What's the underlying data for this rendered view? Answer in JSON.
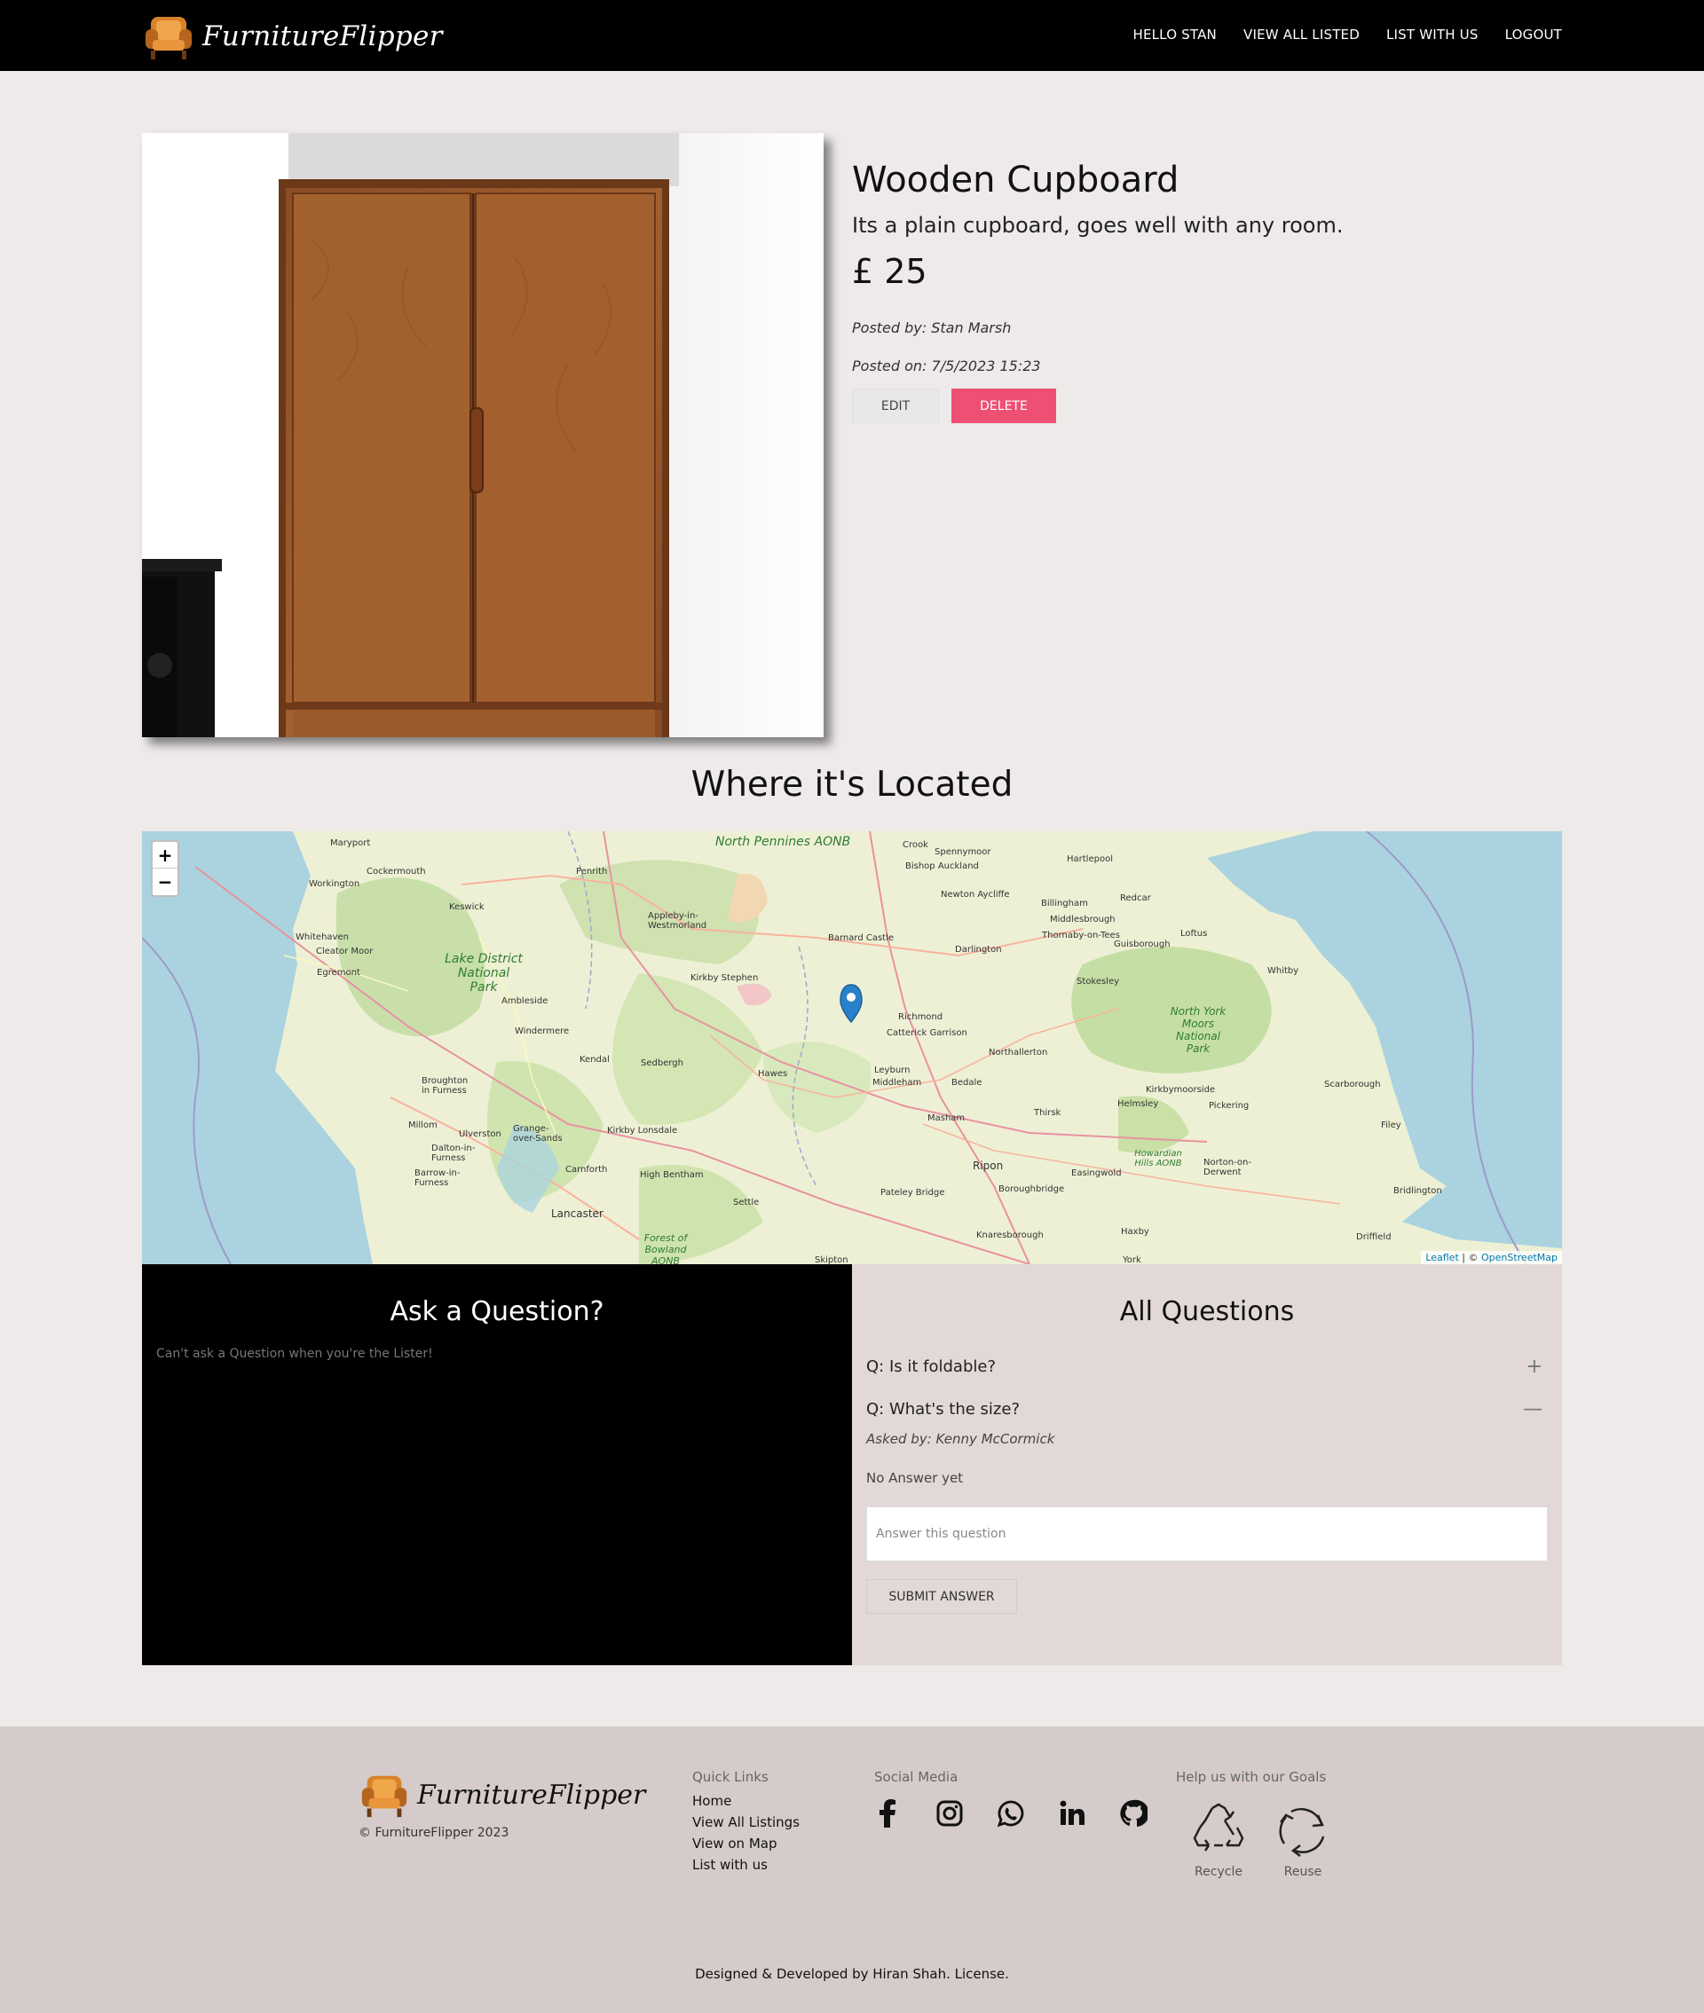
{
  "nav": {
    "brand": "FurnitureFlipper",
    "links": [
      "HELLO STAN",
      "VIEW ALL LISTED",
      "LIST WITH US",
      "LOGOUT"
    ]
  },
  "product": {
    "title": "Wooden Cupboard",
    "description": "Its a plain cupboard, goes well with any room.",
    "price": "£ 25",
    "posted_by": "Posted by: Stan Marsh",
    "posted_on": "Posted on: 7/5/2023 15:23",
    "edit_label": "EDIT",
    "delete_label": "DELETE",
    "delete_color": "#ee5073"
  },
  "location": {
    "heading": "Where it's Located",
    "zoom_in": "+",
    "zoom_out": "−",
    "attribution_leaflet": "Leaflet",
    "attribution_sep": " | © ",
    "attribution_osm": "OpenStreetMap",
    "places": [
      "Maryport",
      "Cockermouth",
      "Workington",
      "Keswick",
      "Penrith",
      "North Pennines AONB",
      "Crook",
      "Spennymoor",
      "Bishop Auckland",
      "Newton Aycliffe",
      "Hartlepool",
      "Billingham",
      "Redcar",
      "Middlesbrough",
      "Thornaby-on-Tees",
      "Guisborough",
      "Loftus",
      "Whitehaven",
      "Cleator Moor",
      "Egremont",
      "Lake District National Park",
      "Appleby-in-Westmorland",
      "Barnard Castle",
      "Darlington",
      "Kirkby Stephen",
      "Stokesley",
      "Whitby",
      "Ambleside",
      "Windermere",
      "Richmond",
      "Catterick Garrison",
      "North York Moors National Park",
      "Kendal",
      "Sedbergh",
      "Hawes",
      "Northallerton",
      "Leyburn",
      "Middleham",
      "Bedale",
      "Scarborough",
      "Kirkbymoorside",
      "Broughton in Furness",
      "Helmsley",
      "Pickering",
      "Millom",
      "Ulverston",
      "Grange-over-Sands",
      "Kirkby Lonsdale",
      "Masham",
      "Thirsk",
      "Filey",
      "Dalton-in-Furness",
      "Barrow-in-Furness",
      "Carnforth",
      "High Bentham",
      "Ripon",
      "Howardian Hills AONB",
      "Easingwold",
      "Norton-on-Derwent",
      "Bridlington",
      "Lancaster",
      "Settle",
      "Pateley Bridge",
      "Boroughbridge",
      "Forest of Bowland AONB",
      "Knaresborough",
      "Haxby",
      "Driffield",
      "Skipton",
      "York"
    ]
  },
  "ask": {
    "title": "Ask a Question?",
    "note": "Can't ask a Question when you're the Lister!"
  },
  "questions": {
    "title": "All Questions",
    "items": [
      {
        "text": "Q: Is it foldable?",
        "toggle": "+"
      },
      {
        "text": "Q: What's the size?",
        "toggle": "—"
      }
    ],
    "asked_by": "Asked by: Kenny McCormick",
    "no_answer": "No Answer yet",
    "answer_placeholder": "Answer this question",
    "submit_label": "SUBMIT ANSWER"
  },
  "footer": {
    "brand": "FurnitureFlipper",
    "copyright": "© FurnitureFlipper 2023",
    "quick_links_title": "Quick Links",
    "quick_links": [
      "Home",
      "View All Listings",
      "View on Map",
      "List with us"
    ],
    "social_title": "Social Media",
    "social_icons": [
      "facebook-icon",
      "instagram-icon",
      "whatsapp-icon",
      "linkedin-icon",
      "github-icon"
    ],
    "goals_title": "Help us with our Goals",
    "goals": [
      "Recycle",
      "Reuse"
    ],
    "credits": "Designed & Developed by Hiran Shah. License."
  }
}
